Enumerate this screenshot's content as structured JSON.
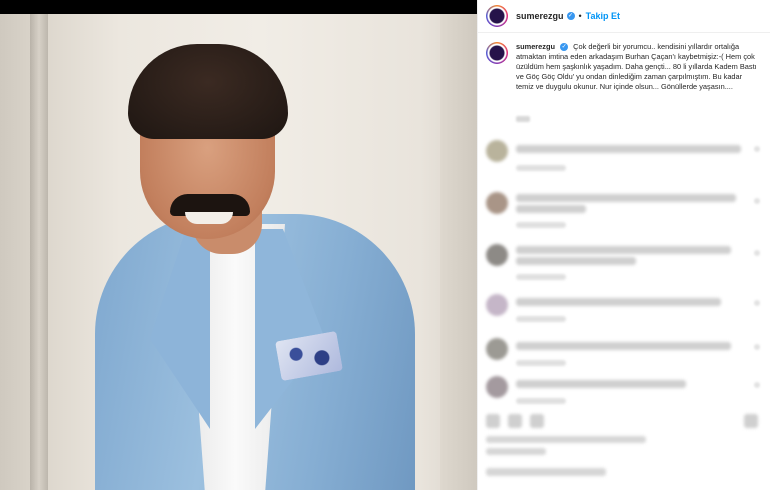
{
  "post": {
    "author": "sumerezgu",
    "follow_label": "Takip Et",
    "separator": "•",
    "verified_mark": "✓",
    "caption_author": "sumerezgu",
    "caption": "Çok değerli bir yorumcu.. kendisini yıllardır ortalığa atmaktan imtina eden arkadaşım Burhan Çaçan'ı kaybetmişiz:-( Hem çok üzüldüm hem şaşkınlık yaşadım. Daha gençti... 80 li yıllarda Kadem Bastı ve Göç Göç Oldu' yu ondan dinlediğim zaman çarpılmıştım. Bu kadar temiz ve duygulu okunur. Nur içinde olsun... Gönüllerde yaşasın...."
  },
  "icons": {
    "verified": "verified-badge-icon",
    "avatar": "profile-avatar"
  },
  "colors": {
    "follow": "#0095f6",
    "verified": "#3897f0",
    "text": "#262626"
  }
}
